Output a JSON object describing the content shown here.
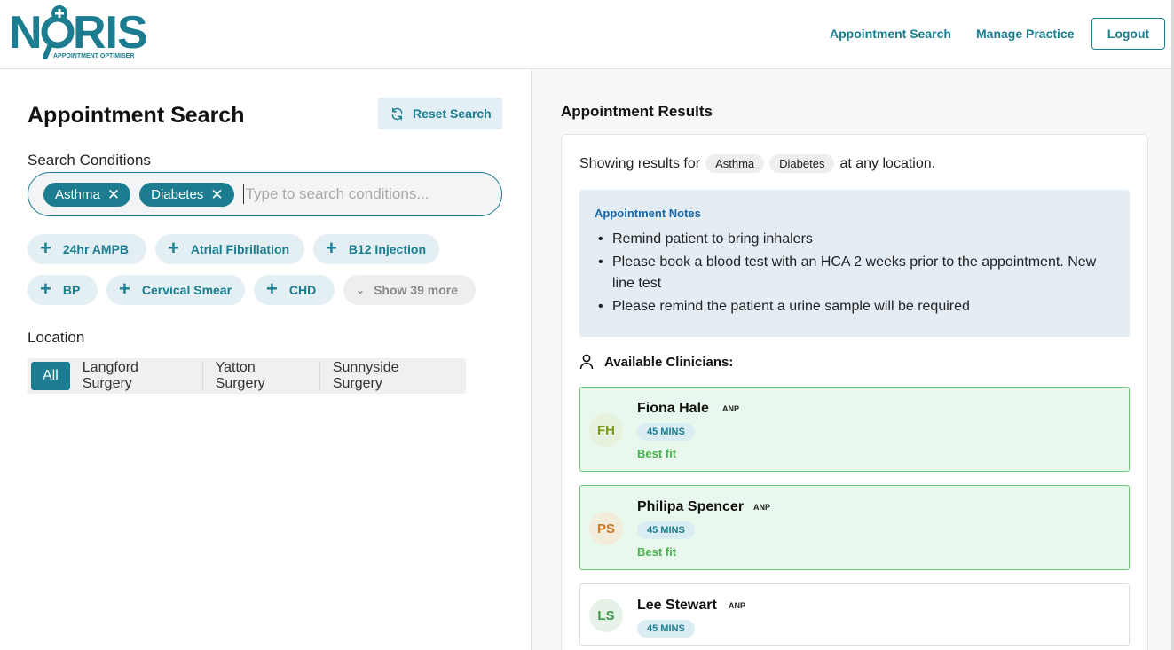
{
  "header": {
    "logo_text": "NORIS",
    "logo_tagline": "APPOINTMENT OPTIMISER",
    "nav": [
      {
        "label": "Appointment Search"
      },
      {
        "label": "Manage Practice"
      }
    ],
    "logout_label": "Logout"
  },
  "search": {
    "title": "Appointment Search",
    "reset_label": "Reset Search",
    "conditions_label": "Search Conditions",
    "selected": [
      {
        "label": "Asthma"
      },
      {
        "label": "Diabetes"
      }
    ],
    "placeholder": "Type to search conditions...",
    "quick_tags": [
      {
        "label": "24hr AMPB"
      },
      {
        "label": "Atrial Fibrillation"
      },
      {
        "label": "B12 Injection"
      },
      {
        "label": "BP"
      },
      {
        "label": "Cervical Smear"
      },
      {
        "label": "CHD"
      }
    ],
    "show_more_label": "Show 39 more",
    "location_label": "Location",
    "locations": [
      {
        "label": "All",
        "active": true
      },
      {
        "label": "Langford Surgery",
        "active": false
      },
      {
        "label": "Yatton Surgery",
        "active": false
      },
      {
        "label": "Sunnyside Surgery",
        "active": false
      }
    ]
  },
  "results": {
    "title": "Appointment Results",
    "showing_prefix": "Showing results for",
    "showing_conditions": [
      "Asthma",
      "Diabetes"
    ],
    "showing_suffix": "at any location.",
    "notes_title": "Appointment Notes",
    "notes": [
      "Remind patient to bring inhalers",
      "Please book a blood test with an HCA 2 weeks prior to the appointment. New line test",
      "Please remind the patient a urine sample will be required"
    ],
    "clinicians_label": "Available Clinicians:",
    "clinicians": [
      {
        "initials": "FH",
        "name": "Fiona Hale",
        "role": "ANP",
        "duration": "45 MINS",
        "fit": "Best fit"
      },
      {
        "initials": "PS",
        "name": "Philipa Spencer",
        "role": "ANP",
        "duration": "45 MINS",
        "fit": "Best fit"
      },
      {
        "initials": "LS",
        "name": "Lee Stewart",
        "role": "ANP",
        "duration": "45 MINS",
        "fit": ""
      }
    ]
  },
  "colors": {
    "brand": "#1b7d8f",
    "best_fit_bg": "#e9f8ec",
    "best_fit_border": "#6ccb7a",
    "notes_bg": "#e4edf4"
  }
}
